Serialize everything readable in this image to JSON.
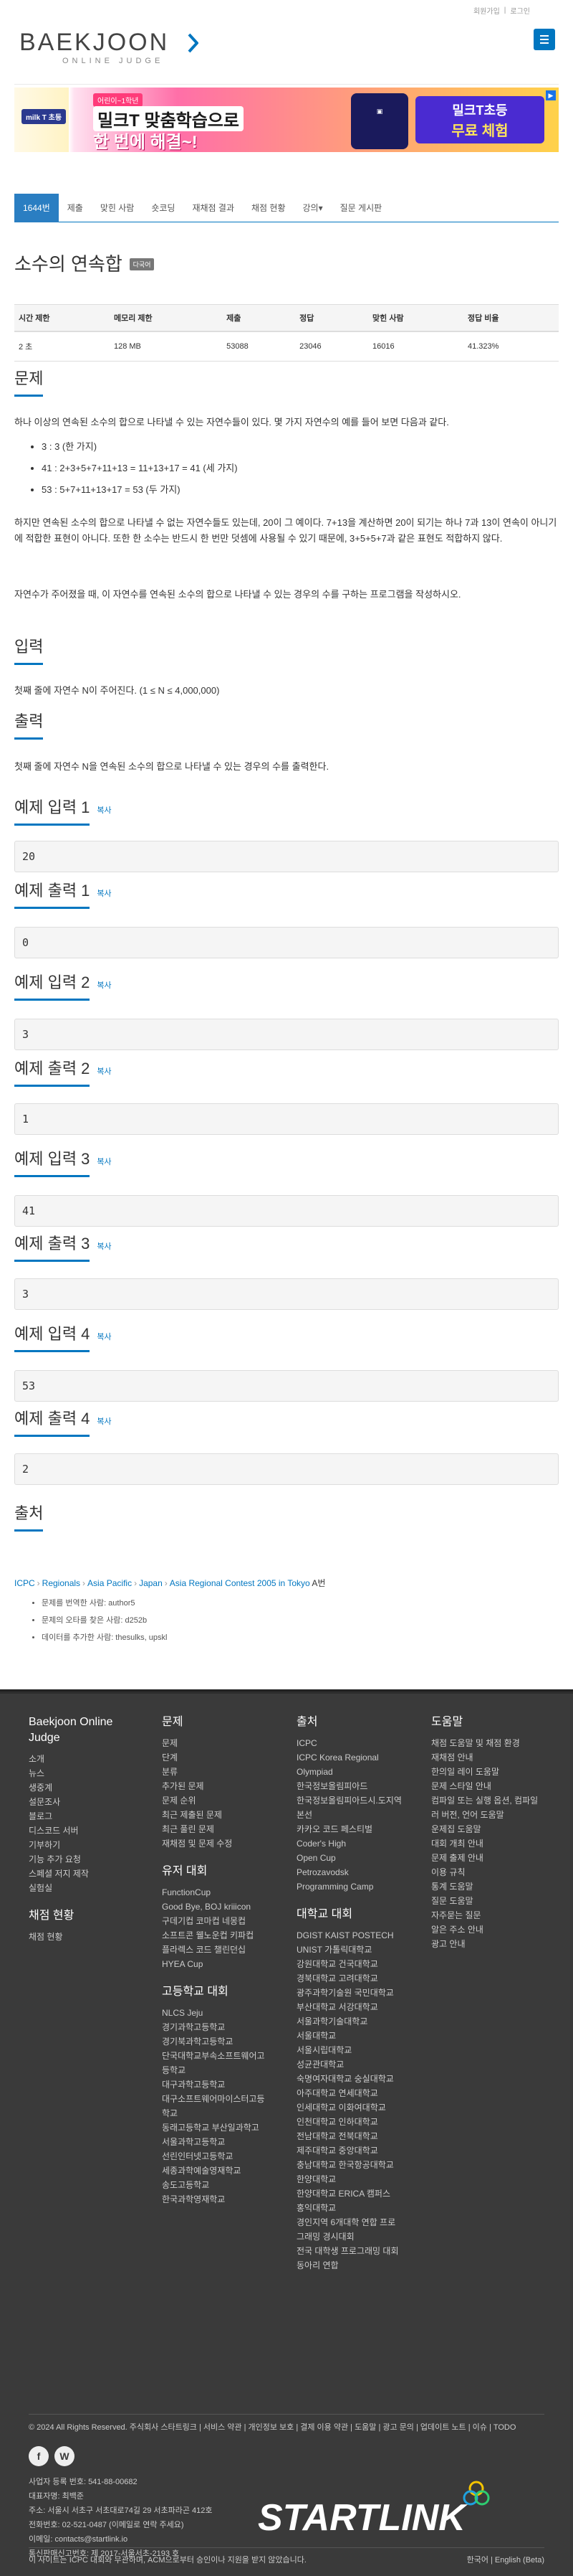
{
  "topbar": {
    "signup": "회원가입",
    "divider": "|",
    "login": "로그인"
  },
  "logo": {
    "top": "BAEKJOON",
    "bottom": "ONLINE JUDGE"
  },
  "ad": {
    "badge": "milk T 초등",
    "sub": "어린이~1학년",
    "line1": "밀크T 맞춤학습으로",
    "line2": "한 번에 해결~!",
    "right1": "밀크T초등",
    "right2": "무료 체험"
  },
  "tabs": [
    "1644번",
    "제출",
    "맞힌 사람",
    "숏코딩",
    "재채점 결과",
    "채점 현황",
    "강의▾",
    "질문 게시판"
  ],
  "problem": {
    "title": "소수의 연속합",
    "lang_label": "다국어",
    "table_headers": [
      "시간 제한",
      "메모리 제한",
      "제출",
      "정답",
      "맞힌 사람",
      "정답 비율"
    ],
    "table_values": [
      "2 초",
      "128 MB",
      "53088",
      "23046",
      "16016",
      "41.323%"
    ]
  },
  "sections": {
    "problem_h": "문제",
    "problem_p1": "하나 이상의 연속된 소수의 합으로 나타낼 수 있는 자연수들이 있다. 몇 가지 자연수의 예를 들어 보면 다음과 같다.",
    "problem_list": [
      "3 : 3 (한 가지)",
      "41 : 2+3+5+7+11+13 = 11+13+17 = 41 (세 가지)",
      "53 : 5+7+11+13+17 = 53 (두 가지)"
    ],
    "problem_p2": "하지만 연속된 소수의 합으로 나타낼 수 없는 자연수들도 있는데, 20이 그 예이다. 7+13을 계산하면 20이 되기는 하나 7과 13이 연속이 아니기에 적합한 표현이 아니다. 또한 한 소수는 반드시 한 번만 덧셈에 사용될 수 있기 때문에, 3+5+5+7과 같은 표현도 적합하지 않다.",
    "problem_p3": "자연수가 주어졌을 때, 이 자연수를 연속된 소수의 합으로 나타낼 수 있는 경우의 수를 구하는 프로그램을 작성하시오.",
    "input_h": "입력",
    "input_p": "첫째 줄에 자연수 N이 주어진다. (1 ≤ N ≤ 4,000,000)",
    "output_h": "출력",
    "output_p": "첫째 줄에 자연수 N을 연속된 소수의 합으로 나타낼 수 있는 경우의 수를 출력한다.",
    "copy": "복사",
    "samples": [
      {
        "title": "예제 입력 1",
        "value": "20"
      },
      {
        "title": "예제 출력 1",
        "value": "0"
      },
      {
        "title": "예제 입력 2",
        "value": "3"
      },
      {
        "title": "예제 출력 2",
        "value": "1"
      },
      {
        "title": "예제 입력 3",
        "value": "41"
      },
      {
        "title": "예제 출력 3",
        "value": "3"
      },
      {
        "title": "예제 입력 4",
        "value": "53"
      },
      {
        "title": "예제 출력 4",
        "value": "2"
      }
    ],
    "source_h": "출처",
    "source": [
      "ICPC",
      "Regionals",
      "Asia Pacific",
      "Japan",
      "Asia Regional Contest 2005 in Tokyo"
    ],
    "source_tail": "A번",
    "credits": [
      "문제를 번역한 사람: author5",
      "문제의 오타를 찾은 사람: d252b",
      "데이터를 추가한 사람: thesulks, upskl"
    ]
  },
  "footer": {
    "col1": {
      "title": "Baekjoon Online Judge",
      "items": [
        "소개",
        "뉴스",
        "생중계",
        "설문조사",
        "블로그",
        "디스코드 서버",
        "기부하기",
        "기능 추가 요청",
        "스페셜 저지 제작",
        "실험실"
      ],
      "title2": "채점 현황",
      "items2": [
        "채점 현황"
      ]
    },
    "col2": {
      "title": "문제",
      "items": [
        "문제",
        "단계",
        "분류",
        "추가된 문제",
        "문제 순위",
        "최근 제출된 문제",
        "최근 풀린 문제",
        "재채점 및 문제 수정"
      ],
      "title2": "유저 대회",
      "items2": [
        "FunctionCup",
        "Good Bye, BOJ kriiicon",
        "구데기컵 코마컵 네몽컵",
        "소프트콘 웰노운컵 키파컵",
        "플라렉스 코드 챌린던십",
        "HYEA Cup"
      ],
      "title3": "고등학교 대회",
      "items3": [
        "NLCS Jeju",
        "경기과학고등학교",
        "경기북과학고등학교",
        "단국대학교부속소프트웨어고",
        "등학교",
        "대구과학고등학교",
        "대구소프트웨어마이스터고등",
        "학교",
        "동래고등학교 부산일과학고",
        "서울과학고등학교",
        "선린인터넷고등학교",
        "세종과학예술영재학교",
        "송도고등학교",
        "한국과학영재학교"
      ]
    },
    "col3": {
      "title": "출처",
      "items": [
        "ICPC",
        "ICPC Korea Regional",
        "Olympiad",
        "한국정보올림피아드",
        "한국정보올림피아드시.도지역",
        "본선",
        "카카오 코드 페스티벌",
        "Coder's High",
        "Open Cup",
        "Petrozavodsk",
        "Programming Camp"
      ],
      "title2": "대학교 대회",
      "items2": [
        "DGIST KAIST POSTECH",
        "UNIST 가톨릭대학교",
        "강원대학교 건국대학교",
        "경북대학교 고려대학교",
        "광주과학기술원 국민대학교",
        "부산대학교 서강대학교",
        "서울과학기술대학교",
        "서울대학교",
        "서울시립대학교",
        "성균관대학교",
        "숙명여자대학교 숭실대학교",
        "아주대학교 연세대학교",
        "인세대학교 이화여대학교",
        "인천대학교 인하대학교",
        "전남대학교 전북대학교",
        "제주대학교 중앙대학교",
        "충남대학교 한국항공대학교",
        "한양대학교",
        "한양대학교 ERICA 캠퍼스",
        "홍익대학교",
        "경인지역 6개대학 연합 프로",
        "그래밍 경시대회",
        "전국 대학생 프로그래밍 대회",
        "동아리 연합"
      ]
    },
    "col4": {
      "title": "도움말",
      "items": [
        "채점 도움말 및 채점 환경",
        "재채점 안내",
        "한의일 레이 도움말",
        "문제 스타일 안내",
        "컴파일 또는 실행 옵션, 컴파일",
        "러 버전, 언어 도움말",
        "운제집 도움말",
        "대회 개최 안내",
        "문제 출제 안내",
        "이용 규칙",
        "통계 도움말",
        "질문 도움말",
        "자주묻는 질문",
        "알은 주소 안내",
        "광고 안내"
      ]
    },
    "links": "© 2024 All Rights Reserved. 주식회사 스타트링크 | 서비스 약관 | 개인정보 보호 | 결제 이용 약관 | 도움말 | 광고 문의 | 업데이트 노트 | 이슈 | TODO",
    "company": [
      "사업자 등록 번호: 541-88-00682",
      "대표자명: 최백준",
      "주소: 서울시 서초구 서초대로74길 29 서초파라곤 412호",
      "전화번호: 02-521-0487 (이메일로 연락 주세요)",
      "이메일: contacts@startlink.io",
      "통신판매신고번호: 제 2017-서울서초-2193 호"
    ],
    "brand": "STARTLINK",
    "notice": "이 사이트는 ICPC 대회와 무관하며, ACM으로부터 승인이나 지원을 받지 않았습니다.",
    "langs": "한국어 | English (Beta)"
  }
}
